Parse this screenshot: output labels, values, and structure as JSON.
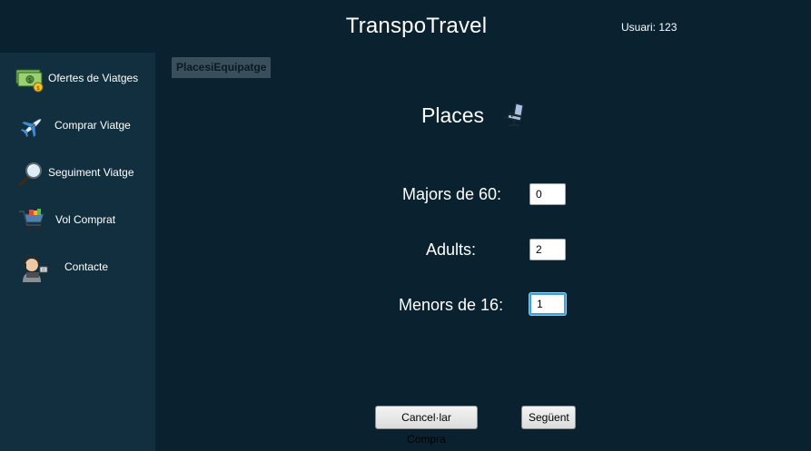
{
  "header": {
    "title": "TranspoTravel",
    "user": "Usuari: 123"
  },
  "sidebar": {
    "items": [
      {
        "label": "Ofertes de Viatges",
        "icon": "money-icon"
      },
      {
        "label": "Comprar Viatge",
        "icon": "airplane-icon"
      },
      {
        "label": "Seguiment Viatge",
        "icon": "magnifier-icon"
      },
      {
        "label": "Vol Comprat",
        "icon": "cart-icon"
      },
      {
        "label": "Contacte",
        "icon": "support-agent-icon"
      }
    ]
  },
  "main": {
    "tab": "PlacesiEquipatge",
    "section_title": "Places",
    "section_icon": "seat-icon",
    "fields": [
      {
        "label": "Majors de 60:",
        "value": "0"
      },
      {
        "label": "Adults:",
        "value": "2"
      },
      {
        "label": "Menors de 16:",
        "value": "1"
      }
    ],
    "buttons": {
      "cancel": "Cancel·lar Compra",
      "next": "Següent"
    }
  },
  "colors": {
    "background": "#0a2230",
    "sidebar": "#112f3e",
    "tab": "#3a4e5c",
    "focus": "#3aa2d6"
  }
}
